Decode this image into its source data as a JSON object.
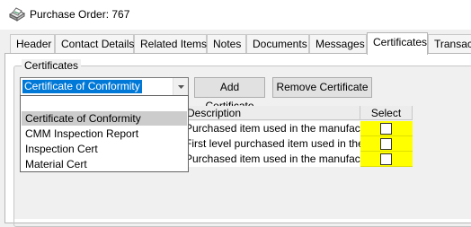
{
  "window": {
    "title": "Purchase Order: 767",
    "icon": "printer-icon"
  },
  "tabs": [
    {
      "label": "Header"
    },
    {
      "label": "Contact Details"
    },
    {
      "label": "Related Items"
    },
    {
      "label": "Notes"
    },
    {
      "label": "Documents"
    },
    {
      "label": "Messages"
    },
    {
      "label": "Certificates",
      "active": true
    },
    {
      "label": "Transact"
    }
  ],
  "certificates": {
    "group_label": "Certificates",
    "selected_certificate": "Certificate of Conformity",
    "add_button": "Add Certificate",
    "remove_button": "Remove Certificate",
    "dropdown_options": [
      "Certificate of Conformity",
      "CMM Inspection Report",
      "Inspection Cert",
      "Material Cert"
    ],
    "highlighted_option_index": 0
  },
  "grid": {
    "columns": [
      "Description",
      "Select"
    ],
    "rows": [
      {
        "description": "Purchased item used in the manufactu...",
        "select": false
      },
      {
        "description": "First level purchased item used in the ...",
        "select": false
      },
      {
        "description": "Purchased item used in the manufactu...",
        "select": false
      }
    ]
  },
  "colors": {
    "selection_blue": "#0078d7",
    "select_column_highlight": "#ffff00",
    "dropdown_highlight": "#cccccc"
  }
}
